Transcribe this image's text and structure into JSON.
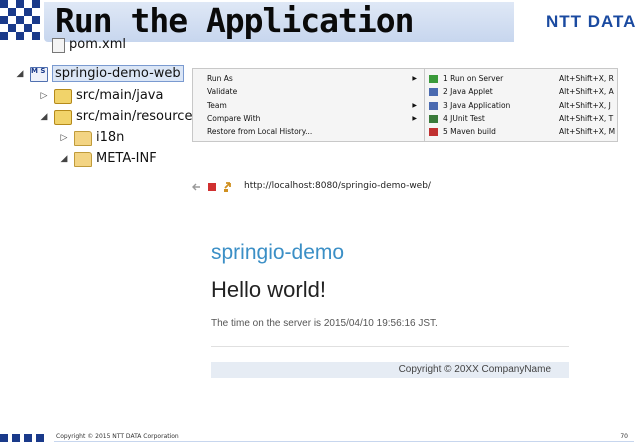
{
  "slide": {
    "title": "Run the Application",
    "logo": "NTT DATA",
    "copyright": "Copyright © 2015 NTT DATA Corporation",
    "page_number": "70"
  },
  "tree": {
    "partial_file": "pom.xml",
    "project": "springio-demo-web",
    "items": [
      {
        "label": "src/main/java",
        "twisty": "▷"
      },
      {
        "label": "src/main/resources",
        "twisty": "◢"
      },
      {
        "label": "i18n",
        "twisty": "▷"
      },
      {
        "label": "META-INF",
        "twisty": "◢"
      }
    ],
    "project_twisty": "◢",
    "project_icon_text": "M S"
  },
  "context_menu": {
    "items": [
      {
        "label": "Run As",
        "arrow": "▶"
      },
      {
        "label": "Validate",
        "arrow": ""
      },
      {
        "label": "Team",
        "arrow": "▶"
      },
      {
        "label": "Compare With",
        "arrow": "▶"
      },
      {
        "label": "Restore from Local History...",
        "arrow": ""
      }
    ]
  },
  "submenu": {
    "items": [
      {
        "label": "1 Run on Server",
        "shortcut": "Alt+Shift+X, R",
        "icon": "server-run-icon",
        "color": "#3a9a3a"
      },
      {
        "label": "2 Java Applet",
        "shortcut": "Alt+Shift+X, A",
        "icon": "java-applet-icon",
        "color": "#4a6ab0"
      },
      {
        "label": "3 Java Application",
        "shortcut": "Alt+Shift+X, J",
        "icon": "java-application-icon",
        "color": "#4a6ab0"
      },
      {
        "label": "4 JUnit Test",
        "shortcut": "Alt+Shift+X, T",
        "icon": "junit-icon",
        "color": "#3a7a3a"
      },
      {
        "label": "5 Maven build",
        "shortcut": "Alt+Shift+X, M",
        "icon": "maven-icon",
        "color": "#c03030"
      }
    ]
  },
  "browser": {
    "url": "http://localhost:8080/springio-demo-web/",
    "site_title": "springio-demo",
    "heading": "Hello world!",
    "server_time": "The time on the server is 2015/04/10 19:56:16 JST.",
    "footer": "Copyright © 20XX CompanyName"
  },
  "colors": {
    "brand": "#1a3a8a",
    "site_title": "#3b8fc6",
    "title_bar": "#c7d6ee"
  }
}
